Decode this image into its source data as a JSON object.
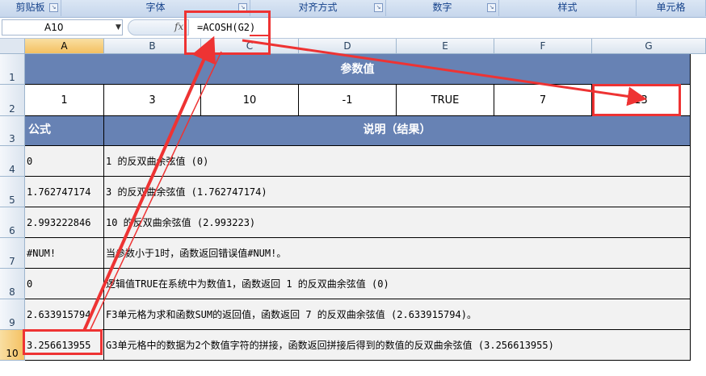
{
  "ribbon": {
    "groups": [
      "剪贴板",
      "字体",
      "对齐方式",
      "数字",
      "样式",
      "单元格"
    ]
  },
  "formula_bar": {
    "name_box": "A10",
    "fx_icon": "fx",
    "formula": "=ACOSH(G2)"
  },
  "columns": [
    "A",
    "B",
    "C",
    "D",
    "E",
    "F",
    "G"
  ],
  "rows": [
    "1",
    "2",
    "3",
    "4",
    "5",
    "6",
    "7",
    "8",
    "9",
    "10"
  ],
  "sheet": {
    "title": "参数值",
    "params": [
      "1",
      "3",
      "10",
      "-1",
      "TRUE",
      "7",
      "13"
    ],
    "header_formula": "公式",
    "header_desc": "说明（结果）",
    "data_rows": [
      {
        "result": "0",
        "desc": "1 的反双曲余弦值 (0)"
      },
      {
        "result": "1.762747174",
        "desc": "3 的反双曲余弦值 (1.762747174)"
      },
      {
        "result": "2.993222846",
        "desc": "10 的反双曲余弦值 (2.993223)"
      },
      {
        "result": "#NUM!",
        "desc": "当参数小于1时，函数返回错误值#NUM!。"
      },
      {
        "result": "0",
        "desc": "逻辑值TRUE在系统中为数值1，函数返回 1 的反双曲余弦值 (0)"
      },
      {
        "result": "2.633915794",
        "desc": "F3单元格为求和函数SUM的返回值，函数返回 7 的反双曲余弦值 (2.633915794)。"
      },
      {
        "result": "3.256613955",
        "desc": "G3单元格中的数据为2个数值字符的拼接，函数返回拼接后得到的数值的反双曲余弦值 (3.256613955)"
      }
    ]
  },
  "colors": {
    "header_fill": "#6782b4",
    "annotation_red": "#ee3333",
    "body_fill": "#f2f2f2"
  }
}
